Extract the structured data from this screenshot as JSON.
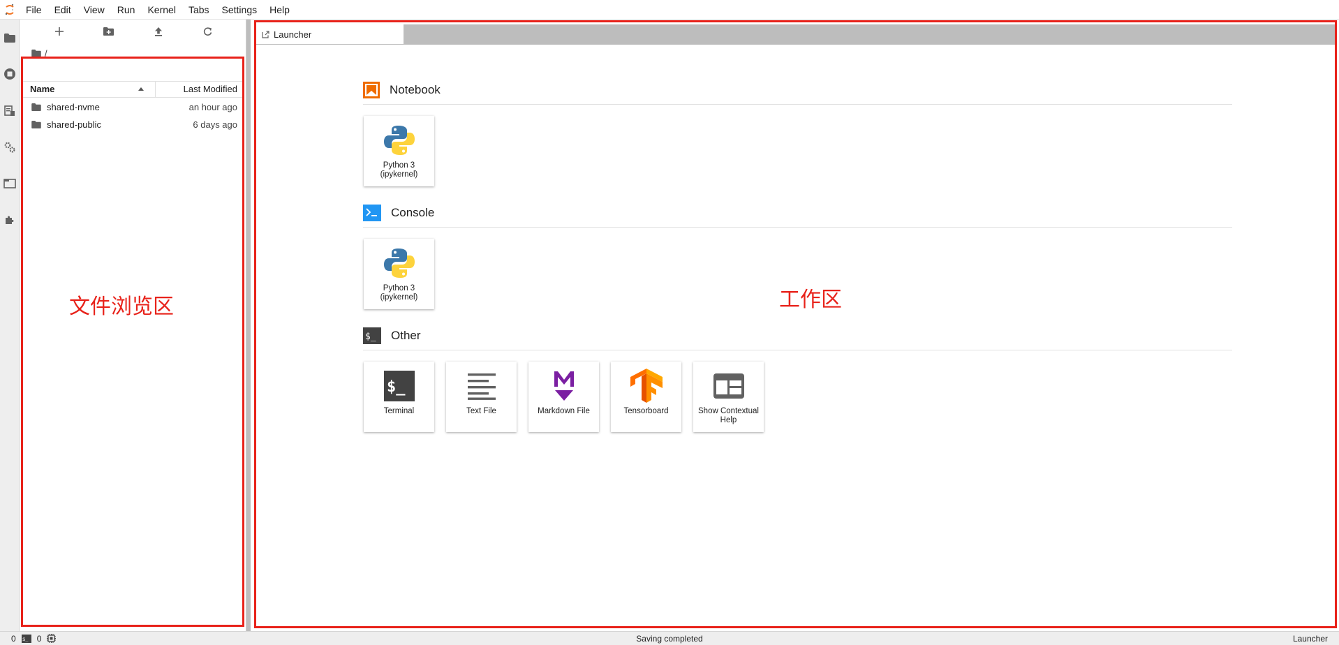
{
  "menubar": {
    "logo_icon": "jupyter-logo-icon",
    "items": [
      "File",
      "Edit",
      "View",
      "Run",
      "Kernel",
      "Tabs",
      "Settings",
      "Help"
    ]
  },
  "left_sidebar": {
    "icons": [
      "folder-icon",
      "running-icon",
      "commands-icon",
      "property-inspector-icon",
      "tabs-icon",
      "extension-icon"
    ]
  },
  "file_browser": {
    "toolbar": [
      "new-launcher-icon",
      "new-folder-icon",
      "upload-icon",
      "refresh-icon"
    ],
    "breadcrumb": "/",
    "columns": {
      "name": "Name",
      "modified": "Last Modified"
    },
    "rows": [
      {
        "name": "shared-nvme",
        "modified": "an hour ago"
      },
      {
        "name": "shared-public",
        "modified": "6 days ago"
      }
    ]
  },
  "tabs": [
    {
      "label": "Launcher",
      "icon": "launcher-icon"
    }
  ],
  "launcher": {
    "sections": [
      {
        "title": "Notebook",
        "icon": "notebook-icon",
        "cards": [
          {
            "label": "Python 3 (ipykernel)",
            "icon": "python-icon"
          }
        ]
      },
      {
        "title": "Console",
        "icon": "console-icon",
        "cards": [
          {
            "label": "Python 3 (ipykernel)",
            "icon": "python-icon"
          }
        ]
      },
      {
        "title": "Other",
        "icon": "terminal-icon",
        "cards": [
          {
            "label": "Terminal",
            "icon": "terminal-icon"
          },
          {
            "label": "Text File",
            "icon": "text-file-icon"
          },
          {
            "label": "Markdown File",
            "icon": "markdown-icon"
          },
          {
            "label": "Tensorboard",
            "icon": "tensorflow-icon"
          },
          {
            "label": "Show Contextual Help",
            "icon": "contextual-help-icon"
          }
        ]
      }
    ]
  },
  "annotations": {
    "file_area": "文件浏览区",
    "work_area": "工作区",
    "color": "#e8221a"
  },
  "statusbar": {
    "terminals_count": "0",
    "kernels_count": "0",
    "status": "Saving completed",
    "mode": "Launcher"
  },
  "colors": {
    "notebook_accent": "#ef6c00",
    "console_accent": "#2196f3",
    "terminal_bg": "#424242",
    "markdown_accent": "#7b1fa2",
    "tensorflow_orange": "#ff8f00"
  }
}
